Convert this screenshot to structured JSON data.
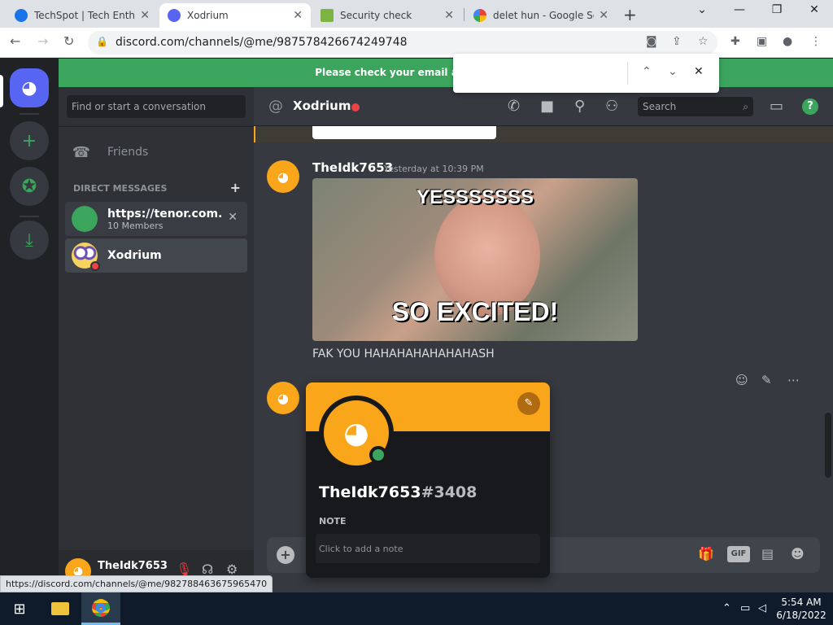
{
  "browser": {
    "tabs": [
      {
        "title": "TechSpot | Tech Enthusiasts, Power Users, Gamers",
        "icon": "techspot-icon",
        "active": false
      },
      {
        "title": "Xodrium",
        "icon": "discord-icon",
        "active": true
      },
      {
        "title": "Security check",
        "icon": "security-icon",
        "active": false
      },
      {
        "title": "delet hun - Google Search",
        "icon": "google-icon",
        "active": false
      }
    ],
    "url": "discord.com/channels/@me/987578426674249748",
    "find_value": "",
    "status_url": "https://discord.com/channels/@me/982788463675965470"
  },
  "discord": {
    "notice": "Please check your email and follow the instruct",
    "dm_search_placeholder": "Find or start a conversation",
    "friends_label": "Friends",
    "direct_messages_header": "DIRECT MESSAGES",
    "dms": [
      {
        "name": "https://tenor.com...",
        "sub": "10 Members"
      },
      {
        "name": "Xodrium",
        "sub": ""
      }
    ],
    "user": {
      "name": "TheIdk7653"
    },
    "channel": {
      "name": "Xodrium",
      "search_placeholder": "Search"
    },
    "message": {
      "author": "TheIdk7653",
      "timestamp": "Yesterday at 10:39 PM",
      "gif_top_text": "YESSSSSSS",
      "gif_bottom_text": "SO EXCITED!",
      "text": "FAK YOU HAHAHAHAHAHAHASH"
    },
    "popout": {
      "username": "TheIdk7653",
      "discriminator": "#3408",
      "note_label": "NOTE",
      "note_placeholder": "Click to add a note"
    },
    "gif_button_label": "GIF"
  },
  "taskbar": {
    "time": "5:54 AM",
    "date": "6/18/2022"
  },
  "colors": {
    "discord_blurple": "#5865f2",
    "online_green": "#3ba55d",
    "dnd_red": "#ed4245",
    "avatar_orange": "#faa61a"
  }
}
